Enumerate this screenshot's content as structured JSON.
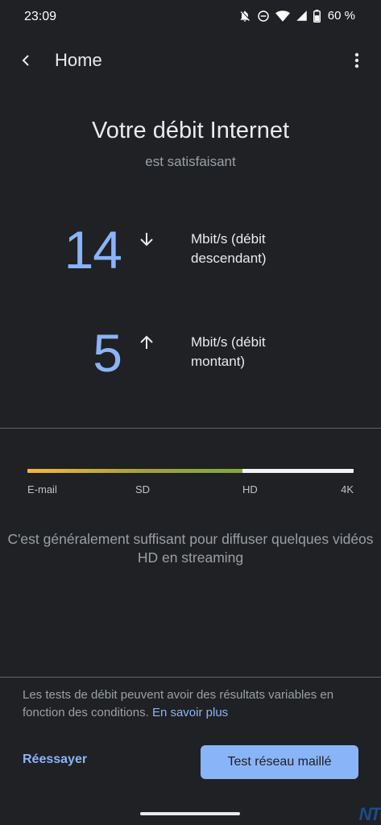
{
  "status_bar": {
    "time": "23:09",
    "battery": "60 %",
    "icons": [
      "notifications-off-icon",
      "do-not-disturb-icon",
      "wifi-icon",
      "signal-icon",
      "battery-icon"
    ]
  },
  "app_bar": {
    "title": "Home",
    "back_icon": "back-arrow-icon",
    "menu_icon": "more-vert-icon"
  },
  "result": {
    "headline": "Votre débit Internet",
    "subhead": "est satisfaisant"
  },
  "download": {
    "value": "14",
    "unit": "Mbit/s (débit descendant)",
    "icon": "arrow-down-icon"
  },
  "upload": {
    "value": "5",
    "unit": "Mbit/s (débit montant)",
    "icon": "arrow-up-icon"
  },
  "quality_scale": {
    "labels": [
      "E-mail",
      "SD",
      "HD",
      "4K"
    ],
    "level_percent": 66,
    "colors": {
      "low": "#f6b935",
      "mid": "#7faa3c",
      "rest": "#f1f3f4"
    }
  },
  "description": "C'est généralement suffisant pour diffuser quelques vidéos HD en streaming",
  "footnote": {
    "text": "Les tests de débit peuvent avoir des résultats variables en fonction des conditions.",
    "link": "En savoir plus"
  },
  "actions": {
    "retry": "Réessayer",
    "mesh_test": "Test réseau maillé"
  },
  "watermark": "NT",
  "colors": {
    "background": "#202124",
    "accent": "#8ab4f8",
    "text_primary": "#e8eaed",
    "text_secondary": "#9aa0a6"
  }
}
